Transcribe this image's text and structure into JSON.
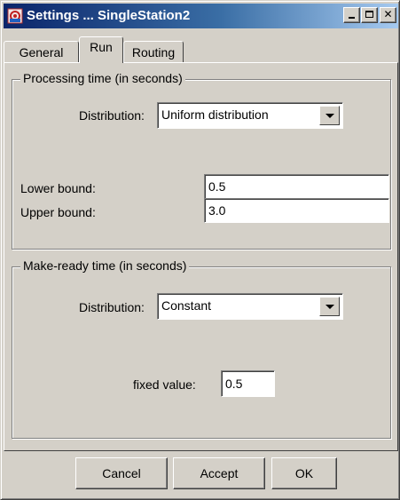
{
  "window": {
    "title": "Settings ... SingleStation2",
    "icon": "app-icon",
    "controls": [
      "minimize",
      "maximize",
      "close"
    ]
  },
  "tabs": [
    {
      "label": "General",
      "selected": false
    },
    {
      "label": "Run",
      "selected": true
    },
    {
      "label": "Routing",
      "selected": false
    }
  ],
  "processing": {
    "legend": "Processing time (in seconds)",
    "distribution_label": "Distribution:",
    "distribution_value": "Uniform distribution",
    "lower_label": "Lower bound:",
    "lower_value": "0.5",
    "upper_label": "Upper bound:",
    "upper_value": "3.0"
  },
  "makeready": {
    "legend": "Make-ready time (in seconds)",
    "distribution_label": "Distribution:",
    "distribution_value": "Constant",
    "fixed_label": "fixed value:",
    "fixed_value": "0.5"
  },
  "buttons": {
    "cancel": "Cancel",
    "accept": "Accept",
    "ok": "OK"
  }
}
